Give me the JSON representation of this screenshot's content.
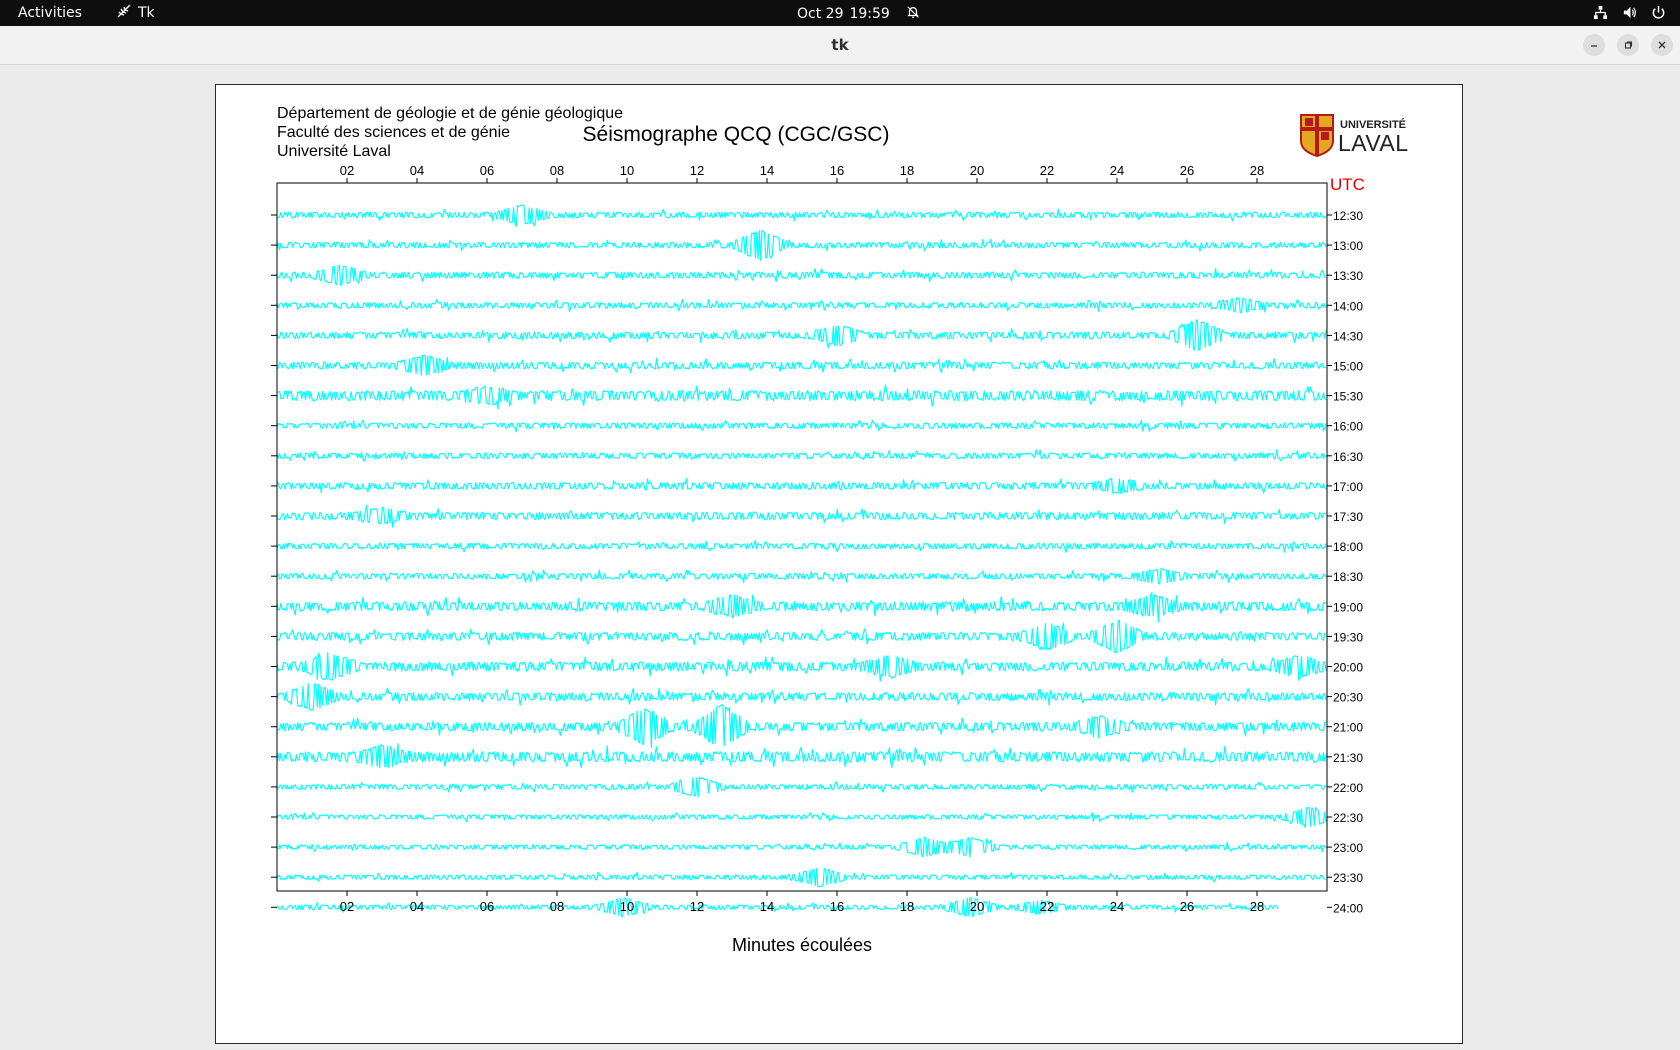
{
  "topbar": {
    "activities": "Activities",
    "app_name": "Tk",
    "date": "Oct 29",
    "time": "19:59"
  },
  "window": {
    "title": "tk"
  },
  "header": {
    "line1": "Département de géologie et de génie géologique",
    "line2": "Faculté des sciences et de génie",
    "line3": "Université Laval"
  },
  "logo": {
    "top": "UNIVERSITÉ",
    "bottom": "LAVAL"
  },
  "chart_data": {
    "type": "seismogram",
    "title": "Séismographe QCQ (CGC/GSC)",
    "xlabel": "Minutes écoulées",
    "right_axis_label": "UTC",
    "x_ticks": [
      "02",
      "04",
      "06",
      "08",
      "10",
      "12",
      "14",
      "16",
      "18",
      "20",
      "22",
      "24",
      "26",
      "28"
    ],
    "xlim": [
      0,
      30
    ],
    "trace_color": "#00ffff",
    "traces": [
      {
        "label": "12:30",
        "amplitude": 1.0,
        "events": [
          {
            "x": 7.0,
            "a": 3
          }
        ]
      },
      {
        "label": "13:00",
        "amplitude": 1.0,
        "events": [
          {
            "x": 13.8,
            "a": 5
          }
        ]
      },
      {
        "label": "13:30",
        "amplitude": 1.1,
        "events": [
          {
            "x": 1.8,
            "a": 3
          }
        ]
      },
      {
        "label": "14:00",
        "amplitude": 1.0,
        "events": [
          {
            "x": 27.5,
            "a": 2
          }
        ]
      },
      {
        "label": "14:30",
        "amplitude": 1.2,
        "events": [
          {
            "x": 26.3,
            "a": 5
          },
          {
            "x": 16.0,
            "a": 3
          }
        ]
      },
      {
        "label": "15:00",
        "amplitude": 1.2,
        "events": [
          {
            "x": 4.2,
            "a": 3
          }
        ]
      },
      {
        "label": "15:30",
        "amplitude": 1.8,
        "events": [
          {
            "x": 6.0,
            "a": 2
          }
        ]
      },
      {
        "label": "16:00",
        "amplitude": 1.0,
        "events": []
      },
      {
        "label": "16:30",
        "amplitude": 1.0,
        "events": []
      },
      {
        "label": "17:00",
        "amplitude": 1.2,
        "events": [
          {
            "x": 24.0,
            "a": 2
          }
        ]
      },
      {
        "label": "17:30",
        "amplitude": 1.3,
        "events": [
          {
            "x": 3.0,
            "a": 2
          }
        ]
      },
      {
        "label": "18:00",
        "amplitude": 1.0,
        "events": []
      },
      {
        "label": "18:30",
        "amplitude": 1.0,
        "events": [
          {
            "x": 25.2,
            "a": 2
          }
        ]
      },
      {
        "label": "19:00",
        "amplitude": 1.6,
        "events": [
          {
            "x": 13.0,
            "a": 3
          },
          {
            "x": 25.0,
            "a": 3
          }
        ]
      },
      {
        "label": "19:30",
        "amplitude": 1.4,
        "events": [
          {
            "x": 22.0,
            "a": 4
          },
          {
            "x": 24.0,
            "a": 5
          }
        ]
      },
      {
        "label": "20:00",
        "amplitude": 1.6,
        "events": [
          {
            "x": 1.5,
            "a": 4
          },
          {
            "x": 17.5,
            "a": 3
          },
          {
            "x": 29.2,
            "a": 3
          }
        ]
      },
      {
        "label": "20:30",
        "amplitude": 1.4,
        "events": [
          {
            "x": 1.0,
            "a": 4
          }
        ]
      },
      {
        "label": "21:00",
        "amplitude": 1.5,
        "events": [
          {
            "x": 10.5,
            "a": 6
          },
          {
            "x": 12.7,
            "a": 7
          },
          {
            "x": 23.5,
            "a": 3
          }
        ]
      },
      {
        "label": "21:30",
        "amplitude": 1.8,
        "events": [
          {
            "x": 3.0,
            "a": 3
          }
        ]
      },
      {
        "label": "22:00",
        "amplitude": 0.9,
        "events": [
          {
            "x": 12.0,
            "a": 3
          }
        ]
      },
      {
        "label": "22:30",
        "amplitude": 0.8,
        "events": [
          {
            "x": 29.5,
            "a": 3
          }
        ]
      },
      {
        "label": "23:00",
        "amplitude": 0.8,
        "events": [
          {
            "x": 18.5,
            "a": 3
          },
          {
            "x": 19.8,
            "a": 3
          }
        ]
      },
      {
        "label": "23:30",
        "amplitude": 0.8,
        "events": [
          {
            "x": 15.5,
            "a": 3
          }
        ]
      },
      {
        "label": "24:00",
        "amplitude": 0.8,
        "end_x": 28.6,
        "events": [
          {
            "x": 9.9,
            "a": 3
          },
          {
            "x": 19.8,
            "a": 3
          },
          {
            "x": 21.8,
            "a": 2
          }
        ]
      }
    ]
  }
}
